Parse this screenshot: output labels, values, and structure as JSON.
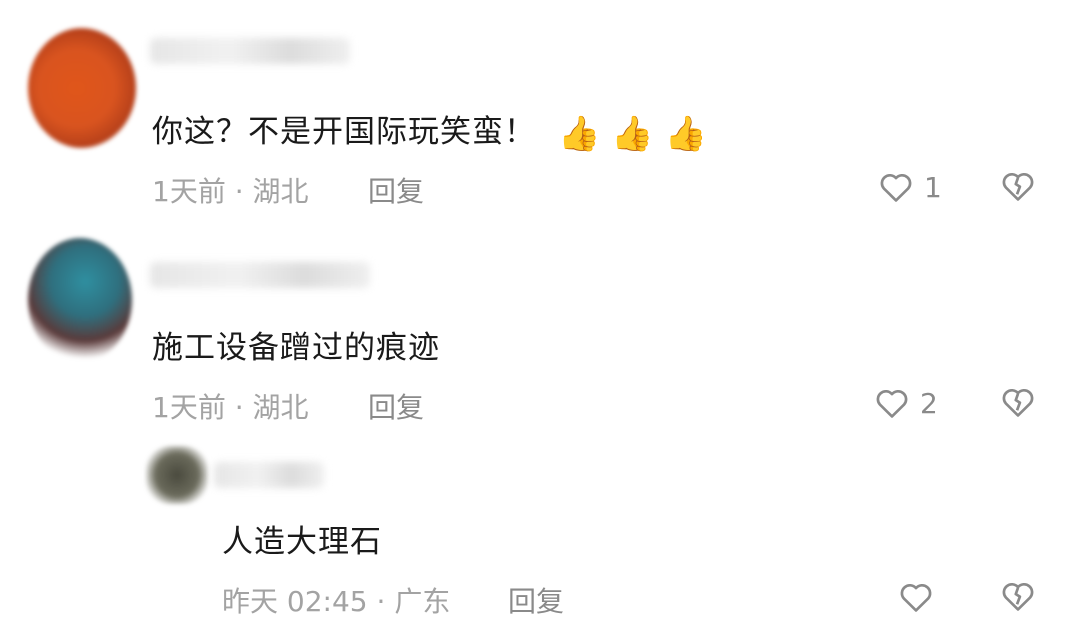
{
  "comments": [
    {
      "text": "你这？不是开国际玩笑蛮！",
      "emojis": [
        "👍",
        "👍",
        "👍"
      ],
      "time": "1天前",
      "separator": "·",
      "location": "湖北",
      "reply_label": "回复",
      "likes": "1",
      "avatar_color": "#d9541f"
    },
    {
      "text": "施工设备蹭过的痕迹",
      "time": "1天前",
      "separator": "·",
      "location": "湖北",
      "reply_label": "回复",
      "likes": "2",
      "avatar_color": "#2f6f7e"
    },
    {
      "text": "人造大理石",
      "time": "昨天 02:45",
      "separator": "·",
      "location": "广东",
      "reply_label": "回复",
      "likes": "",
      "avatar_color": "#5a5a4a"
    }
  ],
  "icons": {
    "like": "heart-outline-icon",
    "dislike": "broken-heart-icon"
  }
}
